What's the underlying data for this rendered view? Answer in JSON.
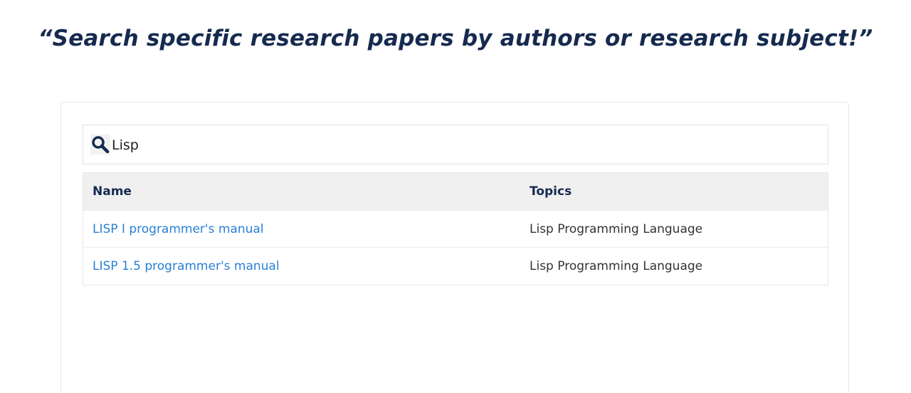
{
  "headline": "“Search specific research papers by authors or research subject!”",
  "search": {
    "icon": "search-icon",
    "value": "Lisp"
  },
  "table": {
    "columns": [
      "Name",
      "Topics"
    ],
    "rows": [
      {
        "name": "LISP I programmer's manual",
        "topic": "Lisp Programming Language"
      },
      {
        "name": "LISP 1.5 programmer's manual",
        "topic": "Lisp Programming Language"
      }
    ]
  },
  "colors": {
    "headline": "#162a4f",
    "link": "#2a7fd4",
    "header_bg": "#f0f0f0"
  }
}
